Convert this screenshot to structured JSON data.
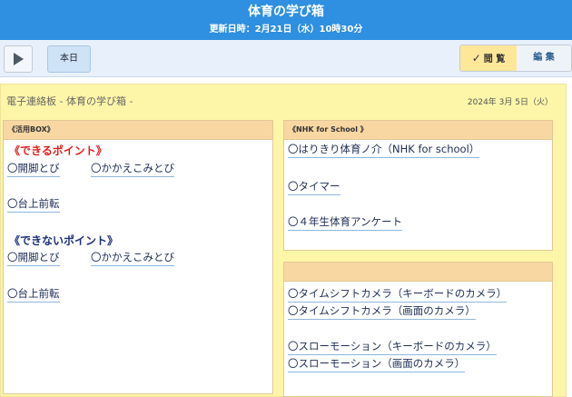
{
  "header": {
    "title": "体育の学び箱",
    "updated": "更新日時：2月21日（水）10時30分"
  },
  "toolbar": {
    "today_label": "本日",
    "view_check": "✓",
    "view_label": "閲 覧",
    "edit_label": "編 集"
  },
  "board": {
    "title": "電子連絡板 - 体育の学び箱 -",
    "date": "2024年 3月 5日（火）"
  },
  "panel_left": {
    "header": "《活用BOX》",
    "can_heading": "《できるポイント》",
    "can_items": [
      "〇開脚とび",
      "〇かかえこみとび",
      "〇台上前転"
    ],
    "cannot_heading": "《できないポイント》",
    "cannot_items": [
      "〇開脚とび",
      "〇かかえこみとび",
      "〇台上前転"
    ]
  },
  "panel_nhk": {
    "header": "《NHK for School 》",
    "items": [
      "〇はりきり体育ノ介（NHK for school）",
      "〇タイマー",
      "〇４年生体育アンケート"
    ]
  },
  "panel_camera": {
    "header": "",
    "items": [
      "〇タイムシフトカメラ（キーボードのカメラ）",
      "〇タイムシフトカメラ（画面のカメラ）",
      "〇スローモーション（キーボードのカメラ）",
      "〇スローモーション（画面のカメラ）"
    ]
  }
}
